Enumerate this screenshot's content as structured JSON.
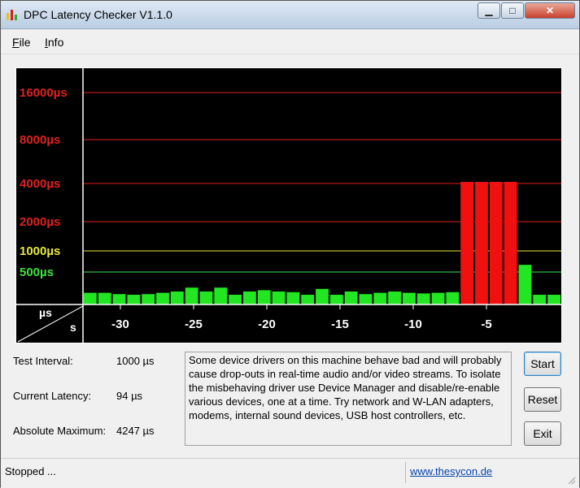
{
  "window": {
    "title": "DPC Latency Checker V1.1.0"
  },
  "menu": {
    "items": [
      {
        "label": "File",
        "accel": "F",
        "rest": "ile"
      },
      {
        "label": "Info",
        "accel": "I",
        "rest": "nfo"
      }
    ]
  },
  "graph": {
    "y_labels": [
      {
        "text": "16000µs",
        "color": "#e02020"
      },
      {
        "text": "8000µs",
        "color": "#e02020"
      },
      {
        "text": "4000µs",
        "color": "#e02020"
      },
      {
        "text": "2000µs",
        "color": "#e02020"
      },
      {
        "text": "1000µs",
        "color": "#e8e840"
      },
      {
        "text": "500µs",
        "color": "#40e040"
      }
    ],
    "corner_top": "µs",
    "corner_bottom": "s",
    "x_ticks": [
      "-30",
      "-25",
      "-20",
      "-15",
      "-10",
      "-5"
    ],
    "bar_heights_px": [],
    "bars": [
      {
        "v": 0.18,
        "c": "g"
      },
      {
        "v": 0.18,
        "c": "g"
      },
      {
        "v": 0.16,
        "c": "g"
      },
      {
        "v": 0.15,
        "c": "g"
      },
      {
        "v": 0.16,
        "c": "g"
      },
      {
        "v": 0.18,
        "c": "g"
      },
      {
        "v": 0.2,
        "c": "g"
      },
      {
        "v": 0.26,
        "c": "g"
      },
      {
        "v": 0.2,
        "c": "g"
      },
      {
        "v": 0.26,
        "c": "g"
      },
      {
        "v": 0.15,
        "c": "g"
      },
      {
        "v": 0.2,
        "c": "g"
      },
      {
        "v": 0.22,
        "c": "g"
      },
      {
        "v": 0.2,
        "c": "g"
      },
      {
        "v": 0.19,
        "c": "g"
      },
      {
        "v": 0.15,
        "c": "g"
      },
      {
        "v": 0.24,
        "c": "g"
      },
      {
        "v": 0.15,
        "c": "g"
      },
      {
        "v": 0.2,
        "c": "g"
      },
      {
        "v": 0.16,
        "c": "g"
      },
      {
        "v": 0.18,
        "c": "g"
      },
      {
        "v": 0.2,
        "c": "g"
      },
      {
        "v": 0.18,
        "c": "g"
      },
      {
        "v": 0.17,
        "c": "g"
      },
      {
        "v": 0.18,
        "c": "g"
      },
      {
        "v": 0.19,
        "c": "g"
      },
      {
        "v": 4.15,
        "c": "r"
      },
      {
        "v": 4.15,
        "c": "r"
      },
      {
        "v": 4.15,
        "c": "r"
      },
      {
        "v": 4.15,
        "c": "r"
      },
      {
        "v": 0.67,
        "c": "g"
      },
      {
        "v": 0.15,
        "c": "g"
      },
      {
        "v": 0.15,
        "c": "g"
      }
    ],
    "colors": {
      "green": "#22e622",
      "red": "#f01010",
      "background": "#000000"
    }
  },
  "info": {
    "test_interval_label": "Test Interval:",
    "test_interval_value": "1000 µs",
    "current_latency_label": "Current Latency:",
    "current_latency_value": "94 µs",
    "absolute_max_label": "Absolute Maximum:",
    "absolute_max_value": "4247 µs"
  },
  "message": "Some device drivers on this machine behave bad and will probably cause drop-outs in real-time audio and/or video streams. To isolate the misbehaving driver use Device Manager and disable/re-enable various devices, one at a time. Try network and W-LAN adapters, modems, internal sound devices, USB host controllers, etc.",
  "buttons": {
    "start": "Start",
    "reset": "Reset",
    "exit": "Exit"
  },
  "status": {
    "text": "Stopped ...",
    "link": "www.thesycon.de"
  }
}
